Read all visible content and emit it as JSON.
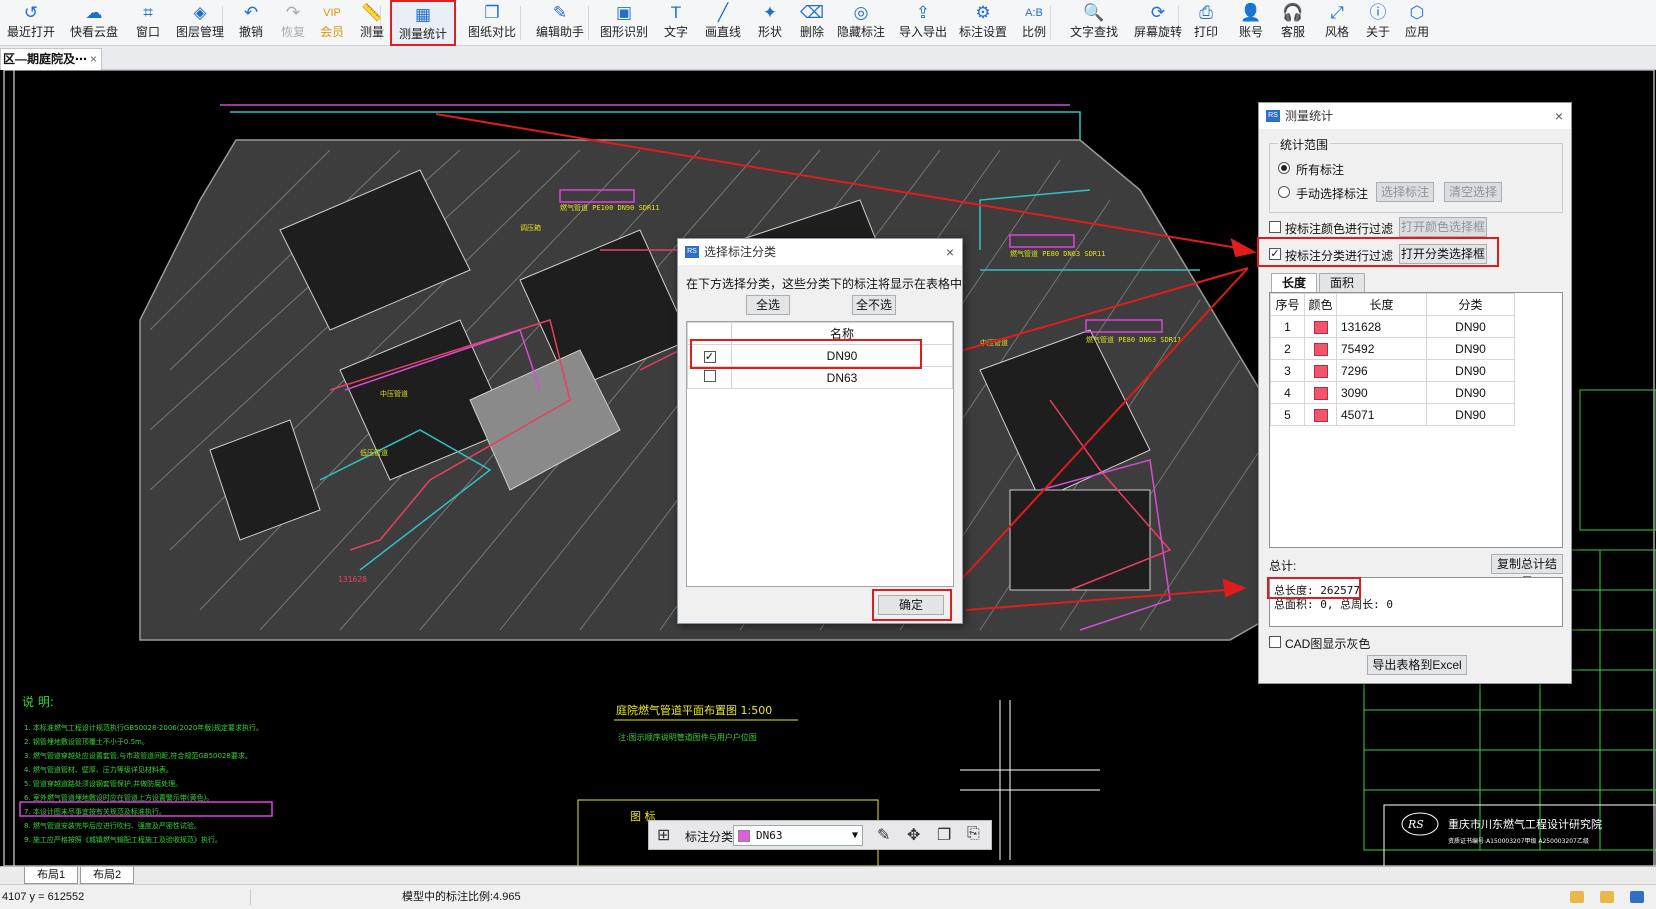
{
  "toolbar": {
    "items": [
      {
        "label": "最近打开",
        "icon": "↺"
      },
      {
        "label": "快看云盘",
        "icon": "☁"
      },
      {
        "label": "窗口",
        "icon": "⌗"
      },
      {
        "label": "图层管理",
        "icon": "◈"
      },
      {
        "label": "撤销",
        "icon": "↶"
      },
      {
        "label": "恢复",
        "icon": "↷"
      },
      {
        "label": "会员",
        "icon": "VIP"
      },
      {
        "label": "测量",
        "icon": "📏"
      },
      {
        "label": "测量统计",
        "icon": "▦"
      },
      {
        "label": "图纸对比",
        "icon": "❐"
      },
      {
        "label": "编辑助手",
        "icon": "✎"
      },
      {
        "label": "图形识别",
        "icon": "▣"
      },
      {
        "label": "文字",
        "icon": "T"
      },
      {
        "label": "画直线",
        "icon": "╱"
      },
      {
        "label": "形状",
        "icon": "✦"
      },
      {
        "label": "删除",
        "icon": "⌫"
      },
      {
        "label": "隐藏标注",
        "icon": "◎"
      },
      {
        "label": "导入导出",
        "icon": "⇪"
      },
      {
        "label": "标注设置",
        "icon": "⚙"
      },
      {
        "label": "比例",
        "icon": "A:B"
      },
      {
        "label": "文字查找",
        "icon": "🔍"
      },
      {
        "label": "屏幕旋转",
        "icon": "⟳"
      },
      {
        "label": "打印",
        "icon": "⎙"
      },
      {
        "label": "账号",
        "icon": "👤"
      },
      {
        "label": "客服",
        "icon": "🎧"
      },
      {
        "label": "风格",
        "icon": "⤢"
      },
      {
        "label": "关于",
        "icon": "ⓘ"
      },
      {
        "label": "应用",
        "icon": "⬡"
      }
    ]
  },
  "doc_tab": {
    "title": "区—期庭院及⋯",
    "close": "×"
  },
  "drawing": {
    "legend_title": "庭院燃气管道平面布置图  1:500",
    "legend_sub": "注:图示顺序说明管道图件与用户户位图",
    "notes_title": "说 明:",
    "notes": [
      "1. 本标准燃气工程设计规范执行GB50028-2006(2020年版)规定要求执行。",
      "2. 钢管埋地敷设管顶覆土不小于0.5m。",
      "3. 燃气管道穿越处应设置套管,与市政管道间距,符合规范GB50028要求。",
      "4. 燃气管道管材、壁厚、压力等级详见材料表。",
      "5. 管道穿越道路处须设钢套管保护,并做防腐处理。",
      "6. 室外燃气管道埋地敷设时应在管道上方设置警示带(黄色)。",
      "7. 本设计图未尽事宜按有关规范及标准执行。",
      "8. 燃气管道安装完毕后应进行吹扫、强度及严密性试验。",
      "9. 施工应严格按照《城镇燃气输配工程施工及验收规范》执行。"
    ],
    "label_131628": "131628",
    "company": "重庆市川东燃气工程设计研究院",
    "company_logo": "RS",
    "cert": "资质证书编号:A150003207甲级  A250003207乙级",
    "title_block": "图 标"
  },
  "mini_toolbar": {
    "category_label": "标注分类",
    "selected": "DN63"
  },
  "select_dialog": {
    "title": "选择标注分类",
    "instruction": "在下方选择分类，这些分类下的标注将显示在表格中",
    "select_all": "全选",
    "select_none": "全不选",
    "column": "名称",
    "rows": [
      {
        "name": "DN90",
        "checked": true
      },
      {
        "name": "DN63",
        "checked": false
      }
    ],
    "ok": "确定"
  },
  "stats_dialog": {
    "title": "测量统计",
    "scope_title": "统计范围",
    "scope_all": "所有标注",
    "scope_manual": "手动选择标注",
    "select_marks": "选择标注",
    "clear_selection": "清空选择",
    "filter_color": "按标注颜色进行过滤",
    "open_color_picker": "打开颜色选择框",
    "filter_category": "按标注分类进行过滤",
    "open_category_picker": "打开分类选择框",
    "tabs": [
      "长度",
      "面积"
    ],
    "columns": [
      "序号",
      "颜色",
      "长度",
      "分类"
    ],
    "rows": [
      {
        "idx": "1",
        "length": "131628",
        "category": "DN90"
      },
      {
        "idx": "2",
        "length": "75492",
        "category": "DN90"
      },
      {
        "idx": "3",
        "length": "7296",
        "category": "DN90"
      },
      {
        "idx": "4",
        "length": "3090",
        "category": "DN90"
      },
      {
        "idx": "5",
        "length": "45071",
        "category": "DN90"
      }
    ],
    "total_label": "总计:",
    "copy_total": "复制总计结果",
    "total_length": "总长度: 262577",
    "total_area": "总面积: 0, 总周长: 0",
    "cad_gray": "CAD图显示灰色",
    "export": "导出表格到Excel"
  },
  "layout_tabs": [
    "布局1",
    "布局2"
  ],
  "status": {
    "coords": "4107 y = 612552",
    "scale_text": "模型中的标注比例:4.965"
  },
  "colors": {
    "accent": "#1f6fd1",
    "highlight": "#e01c1c",
    "swatch": "#f2546b"
  }
}
